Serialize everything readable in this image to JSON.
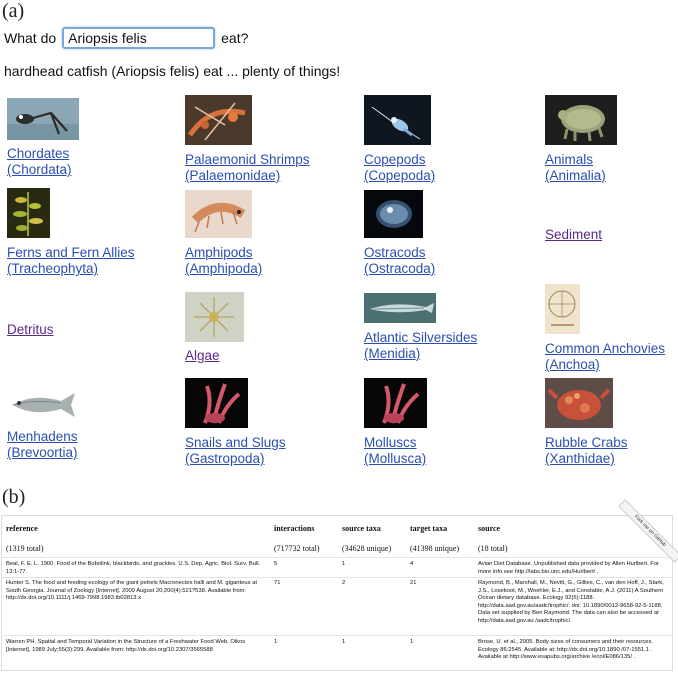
{
  "labels": {
    "a": "(a)",
    "b": "(b)"
  },
  "query": {
    "prefix": "What do",
    "value": "Ariopsis felis",
    "suffix": "eat?"
  },
  "answer": "hardhead catfish (Ariopsis felis) eat ... plenty of things!",
  "prey": [
    {
      "line1": "Chordates",
      "line2": "(Chordata)",
      "icon": "amphibian-photo-icon"
    },
    {
      "line1": "Palaemonid Shrimps",
      "line2": "(Palaemonidae)",
      "icon": "shrimp-photo-icon"
    },
    {
      "line1": "Copepods",
      "line2": "(Copepoda)",
      "icon": "copepod-photo-icon"
    },
    {
      "line1": "Animals",
      "line2": "(Animalia)",
      "icon": "tardigrade-photo-icon"
    },
    {
      "line1": "Ferns and Fern Allies",
      "line2": "(Tracheophyta)",
      "icon": "plant-photo-icon"
    },
    {
      "line1": "Amphipods",
      "line2": "(Amphipoda)",
      "icon": "amphipod-photo-icon"
    },
    {
      "line1": "Ostracods",
      "line2": "(Ostracoda)",
      "icon": "ostracod-photo-icon"
    },
    {
      "line1": "Sediment",
      "line2": ""
    },
    {
      "line1": "Detritus",
      "line2": ""
    },
    {
      "line1": "Algae",
      "line2": "",
      "icon": "algae-photo-icon"
    },
    {
      "line1": "Atlantic Silversides",
      "line2": "(Menidia)",
      "icon": "silverside-photo-icon"
    },
    {
      "line1": "Common Anchovies",
      "line2": "(Anchoa)",
      "icon": "anchovy-drawing-icon"
    },
    {
      "line1": "Menhadens",
      "line2": "(Brevoortia)",
      "icon": "menhaden-photo-icon"
    },
    {
      "line1": "Snails and Slugs",
      "line2": "(Gastropoda)",
      "icon": "sea-slug-photo-icon"
    },
    {
      "line1": "Molluscs",
      "line2": "(Mollusca)",
      "icon": "mollusc-photo-icon"
    },
    {
      "line1": "Rubble Crabs",
      "line2": "(Xanthidae)",
      "icon": "crab-photo-icon"
    }
  ],
  "table": {
    "ribbon": "Fork me on GitHub",
    "headers": [
      "reference",
      "interactions",
      "source taxa",
      "target taxa",
      "source"
    ],
    "totals": [
      "(1319 total)",
      "(717732 total)",
      "(34628 unique)",
      "(41398 unique)",
      "(18 total)"
    ],
    "rows": [
      {
        "reference": "Beal, F. E. L. 1900. Food of the Bobolink, blackbirds, and grackles. U.S. Dep. Agric. Biol. Surv. Bull. 13:1-77.",
        "interactions": "5",
        "source_taxa": "1",
        "target_taxa": "4",
        "source": "Avian Diet Database. Unpublished data provided by Allen Hurlbert. For more info see http://labs.bio.unc.edu/Hurlbert/ ."
      },
      {
        "reference": "Hunter S. The food and feeding ecology of the giant petrels Macronectes halli and M. giganteus at South Georgia. Journal of Zoology [Internet]. 2009 August 20;200(4):521?538. Available from: http://dx.doi.org/10.1111/j.1469-7998.1983.tb02813.x",
        "interactions": "71",
        "source_taxa": "2",
        "target_taxa": "21",
        "source": "Raymond, B., Marshall, M., Nevitt, G., Gillies, C., van den Hoff, J., Stark, J.S., Losekoot, M., Woehler, E.J., and Constable, A.J. (2011) A Southern Ocean dietary database. Ecology 92(5):1188. http://data.aad.gov.au/aadc/trophic/. doi: 10.1890/0012-9658-92-5-1188. Data set supplied by Ben Raymond. The data can also be accessed at http://data.aad.gov.au /aadc/trophic/."
      },
      {
        "reference": "Warren PH. Spatial and Temporal Variation in the Structure of a Freshwater Food Web. Oikos [Internet]. 1989 July;55(3):299. Available from: http://dx.doi.org/10.2307/3565588",
        "interactions": "1",
        "source_taxa": "1",
        "target_taxa": "1",
        "source": "Brose, U. et al., 2005. Body sizes of consumers and their resources. Ecology 86:2545. Available at: http://dx.doi.org/10.1890 /07-1551.1 . Available at http://www.esapubs.org/archive /ecol/E086/135/ ."
      }
    ]
  }
}
